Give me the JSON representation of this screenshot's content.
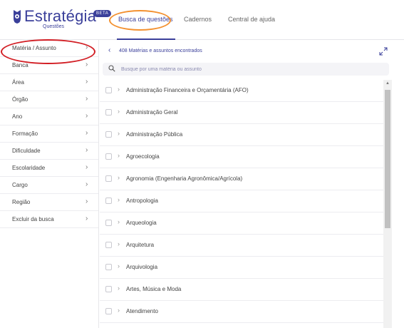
{
  "logo": {
    "title": "Estratégia",
    "subtitle": "Questões",
    "badge": "BETA"
  },
  "nav": {
    "items": [
      "Busca de questões",
      "Cadernos",
      "Central de ajuda"
    ],
    "active": "Busca de questões"
  },
  "sidebar": {
    "items": [
      "Matéria / Assunto",
      "Banca",
      "Área",
      "Órgão",
      "Ano",
      "Formação",
      "Dificuldade",
      "Escolaridade",
      "Cargo",
      "Região",
      "Excluir da busca"
    ]
  },
  "results": {
    "count_text": "408 Matérias e assuntos encontrados"
  },
  "search": {
    "placeholder": "Busque por uma matéria ou assunto",
    "value": ""
  },
  "list": {
    "items": [
      "Administração Financeira e Orçamentária (AFO)",
      "Administração Geral",
      "Administração Pública",
      "Agroecologia",
      "Agronomia (Engenharia Agronômica/Agrícola)",
      "Antropologia",
      "Arqueologia",
      "Arquitetura",
      "Arquivologia",
      "Artes, Música e Moda",
      "Atendimento"
    ]
  },
  "colors": {
    "brand": "#3a3f9a",
    "highlight_orange": "#f39130",
    "highlight_red": "#d21e24"
  },
  "icons": {
    "back": "chevron-left-icon",
    "expand": "expand-icon",
    "search": "search-icon",
    "row_chevron": "chevron-right-icon"
  }
}
